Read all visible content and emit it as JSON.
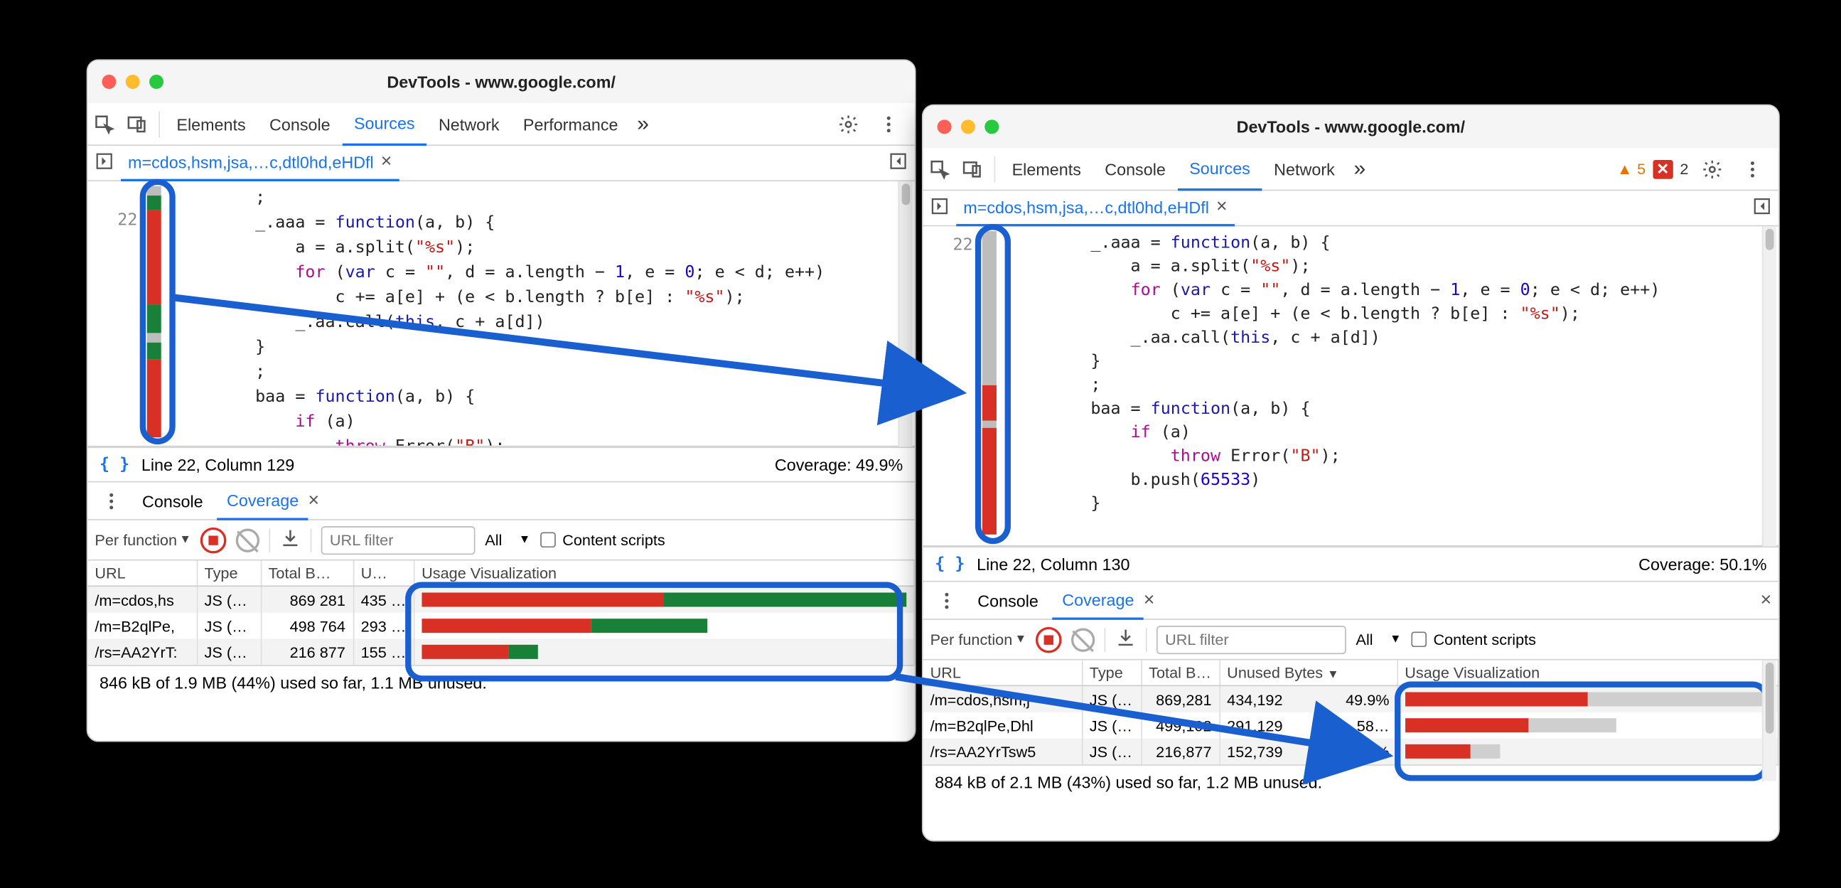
{
  "left": {
    "title": "DevTools - www.google.com/",
    "tabs": [
      "Elements",
      "Console",
      "Sources",
      "Network",
      "Performance"
    ],
    "active_tab": "Sources",
    "file_tab": "m=cdos,hsm,jsa,…c,dtl0hd,eHDfl",
    "line_no": "22",
    "status_line": "Line 22, Column 129",
    "coverage_label": "Coverage: 49.9%",
    "drawer_tabs": [
      "Console",
      "Coverage"
    ],
    "drawer_active": "Coverage",
    "perfunc": "Per function",
    "url_filter_placeholder": "URL filter",
    "type_select": "All",
    "content_scripts": "Content scripts",
    "table": {
      "cols": [
        "URL",
        "Type",
        "Total B…",
        "U…",
        "Usage Visualization"
      ],
      "rows": [
        {
          "url": "/m=cdos,hs",
          "type": "JS (…",
          "total": "869 281",
          "unused": "435 …",
          "red": 50,
          "green": 50
        },
        {
          "url": "/m=B2qlPe,",
          "type": "JS (…",
          "total": "498 764",
          "unused": "293 …",
          "red": 35,
          "green": 24
        },
        {
          "url": "/rs=AA2YrT:",
          "type": "JS (…",
          "total": "216 877",
          "unused": "155 …",
          "red": 18,
          "green": 6
        }
      ]
    },
    "summary": "846 kB of 1.9 MB (44%) used so far, 1.1 MB unused."
  },
  "right": {
    "title": "DevTools - www.google.com/",
    "tabs": [
      "Elements",
      "Console",
      "Sources",
      "Network"
    ],
    "active_tab": "Sources",
    "warnings": "5",
    "errors": "2",
    "file_tab": "m=cdos,hsm,jsa,…c,dtl0hd,eHDfl",
    "line_no": "22",
    "status_line": "Line 22, Column 130",
    "coverage_label": "Coverage: 50.1%",
    "drawer_tabs": [
      "Console",
      "Coverage"
    ],
    "drawer_active": "Coverage",
    "perfunc": "Per function",
    "url_filter_placeholder": "URL filter",
    "type_select": "All",
    "content_scripts": "Content scripts",
    "table": {
      "cols": [
        "URL",
        "Type",
        "Total B…",
        "Unused Bytes",
        "Usage Visualization"
      ],
      "rows": [
        {
          "url": "/m=cdos,hsm,j",
          "type": "JS (…",
          "total": "869,281",
          "unused": "434,192",
          "pct": "49.9%",
          "red": 50,
          "gray": 50
        },
        {
          "url": "/m=B2qlPe,Dhl",
          "type": "JS (…",
          "total": "499,102",
          "unused": "291,129",
          "pct": "58…",
          "red": 34,
          "gray": 24
        },
        {
          "url": "/rs=AA2YrTsw5",
          "type": "JS (…",
          "total": "216,877",
          "unused": "152,739",
          "pct": "70.4%",
          "red": 18,
          "gray": 8
        }
      ]
    },
    "summary": "884 kB of 2.1 MB (43%) used so far, 1.2 MB unused."
  },
  "code": {
    "l1": "        ;",
    "l2a": "        _.aaa = ",
    "l2b": "function",
    "l2c": "(a, b) {",
    "l3a": "            a = a.split(",
    "l3b": "\"%s\"",
    "l3c": ");",
    "l4a": "            ",
    "l4b": "for",
    "l4c": " (",
    "l4d": "var",
    "l4e": " c = ",
    "l4f": "\"\"",
    "l4g": ", d = a.length − ",
    "l4h": "1",
    "l4i": ", e = ",
    "l4j": "0",
    "l4k": "; e < d; e++)",
    "l5a": "                c += a[e] + (e < b.length ? b[e] : ",
    "l5b": "\"%s\"",
    "l5c": ");",
    "l6a": "            _.aa.call(",
    "l6b": "this",
    "l6c": ", c + a[d])",
    "l7": "        }",
    "l8": "        ;",
    "l9a": "        baa = ",
    "l9b": "function",
    "l9c": "(a, b) {",
    "l10a": "            ",
    "l10b": "if",
    "l10c": " (a)",
    "l11a": "                ",
    "l11b": "throw",
    "l11c": " Error(",
    "l11d": "\"B\"",
    "l11e": ");",
    "l12a": "            b.push(",
    "l12b": "65533",
    "l12c": ")",
    "l13": "        }"
  }
}
